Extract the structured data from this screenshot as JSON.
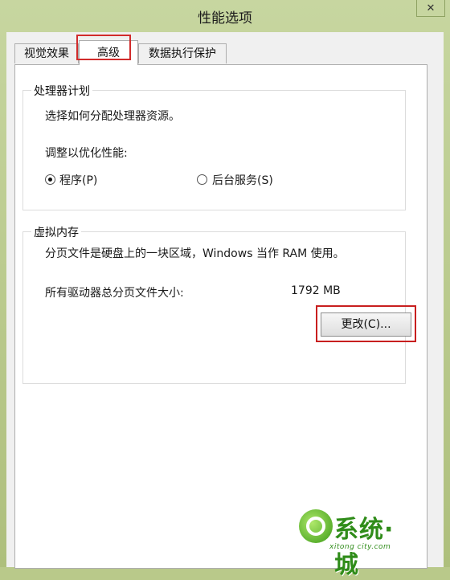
{
  "window": {
    "title": "性能选项",
    "close_symbol": "✕"
  },
  "tabs": [
    {
      "label": "视觉效果",
      "selected": false
    },
    {
      "label": "高级",
      "selected": true
    },
    {
      "label": "数据执行保护",
      "selected": false
    }
  ],
  "processor": {
    "legend": "处理器计划",
    "description": "选择如何分配处理器资源。",
    "adjust_label": "调整以优化性能:",
    "options": [
      {
        "label": "程序(P)",
        "checked": true
      },
      {
        "label": "后台服务(S)",
        "checked": false
      }
    ]
  },
  "virtual_memory": {
    "legend": "虚拟内存",
    "description": "分页文件是硬盘上的一块区域，Windows 当作 RAM 使用。",
    "total_label": "所有驱动器总分页文件大小:",
    "total_value": "1792 MB",
    "change_button": "更改(C)..."
  },
  "watermark": {
    "main": "系统·城",
    "sub": "xitong city.com"
  },
  "colors": {
    "highlight": "#d12b2b",
    "frame": "#b9c98a"
  }
}
